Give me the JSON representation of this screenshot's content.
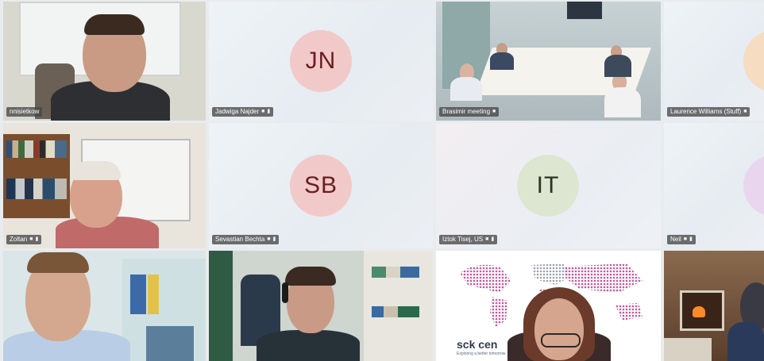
{
  "tiles": [
    {
      "label": "nnisietkow",
      "initials": ""
    },
    {
      "label": "Jadwiga Najder",
      "initials": "JN"
    },
    {
      "label": "Brasimir meeting",
      "initials": ""
    },
    {
      "label": "Laurence Williams (Stuff)",
      "initials": ""
    },
    {
      "label": "Zoltan",
      "initials": ""
    },
    {
      "label": "Sevastian Bechta",
      "initials": "SB"
    },
    {
      "label": "Iztok Tisej, US",
      "initials": "IT"
    },
    {
      "label": "Neil",
      "initials": ""
    },
    {
      "label": "",
      "initials": ""
    },
    {
      "label": "",
      "initials": ""
    },
    {
      "label": "",
      "initials": ""
    },
    {
      "label": "",
      "initials": ""
    }
  ],
  "logo": {
    "name": "sck cen",
    "tagline": "Exploring a better tomorrow"
  },
  "icons": {
    "camera": "camera-icon",
    "mic": "mic-icon"
  },
  "colors": {
    "active_border": "#5a6fcf",
    "pink_avatar": "#f2c9c9",
    "green_avatar": "#dde6d1"
  }
}
